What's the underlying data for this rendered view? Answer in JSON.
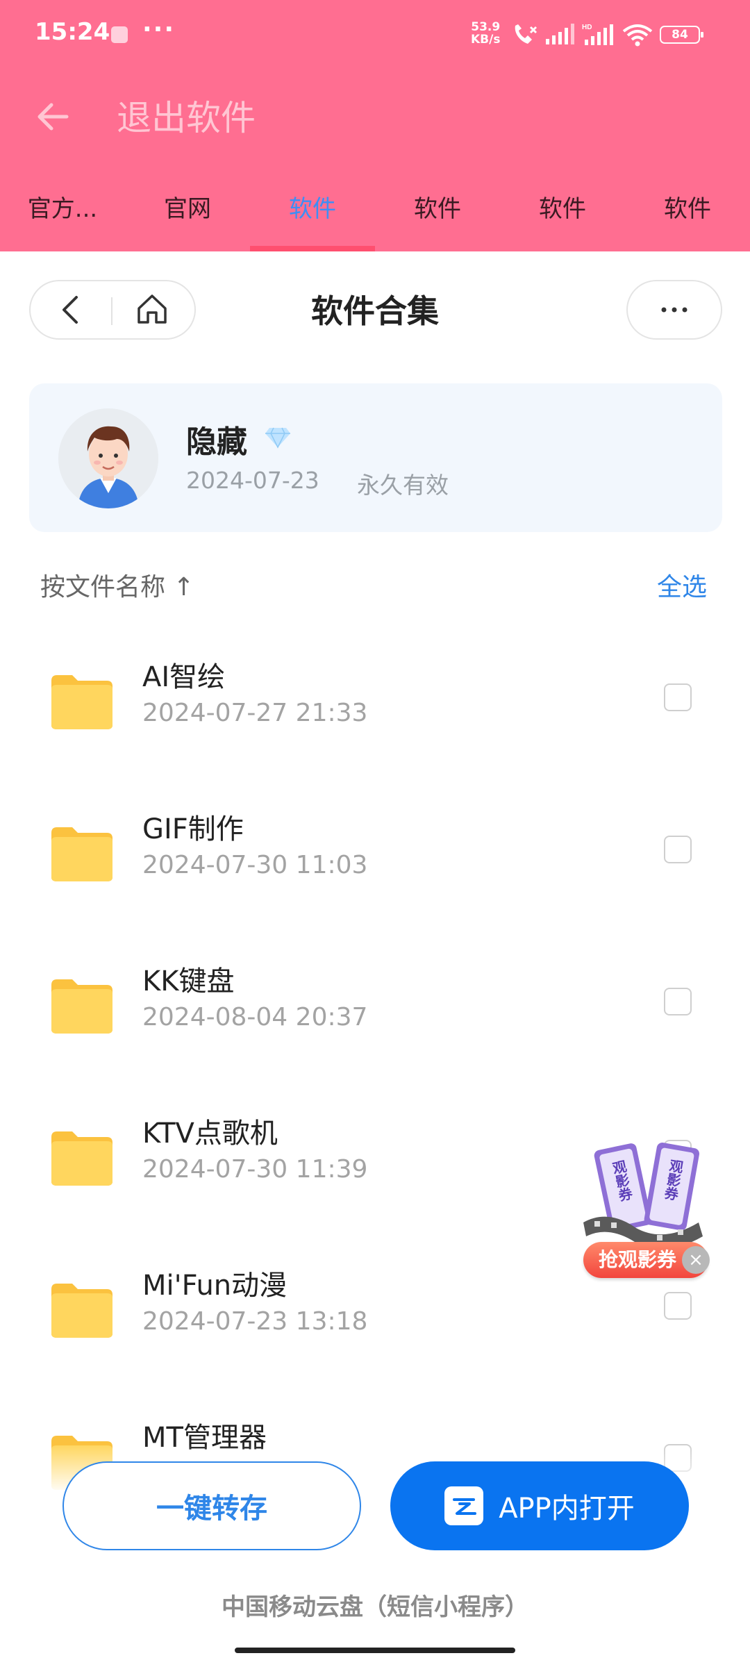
{
  "status_bar": {
    "time": "15:24",
    "net_speed_value": "53.9",
    "net_speed_unit": "KB/s",
    "battery": "84",
    "icons": [
      "app-notification-icon",
      "more-dots-icon",
      "call-icon",
      "signal-icon",
      "hd-signal-icon",
      "wifi-icon",
      "battery-icon"
    ]
  },
  "header": {
    "title": "退出软件",
    "tabs": [
      "官方...",
      "官网",
      "软件",
      "软件",
      "软件",
      "软件"
    ],
    "active_tab_index": 2,
    "colors": {
      "background": "#ff6e91",
      "active_tab": "#3d8ef5",
      "underline": "#ff4f6f"
    }
  },
  "toolbar": {
    "title": "软件合集"
  },
  "user_card": {
    "name": "隐藏",
    "date": "2024-07-23",
    "validity": "永久有效"
  },
  "sort": {
    "label": "按文件名称 ↑",
    "select_all": "全选"
  },
  "files": [
    {
      "name": "AI智绘",
      "date": "2024-07-27 21:33"
    },
    {
      "name": "GIF制作",
      "date": "2024-07-30 11:03"
    },
    {
      "name": "KK键盘",
      "date": "2024-08-04 20:37"
    },
    {
      "name": "KTV点歌机",
      "date": "2024-07-30 11:39"
    },
    {
      "name": "Mi'Fun动漫",
      "date": "2024-07-23 13:18"
    },
    {
      "name": "MT管理器",
      "date": ""
    }
  ],
  "promo": {
    "ticket_text": "观影券",
    "button": "抢观影券",
    "close": "×"
  },
  "actions": {
    "save": "一键转存",
    "open_in_app": "APP内打开",
    "accent": "#0a74f0"
  },
  "footer": "中国移动云盘（短信小程序）"
}
